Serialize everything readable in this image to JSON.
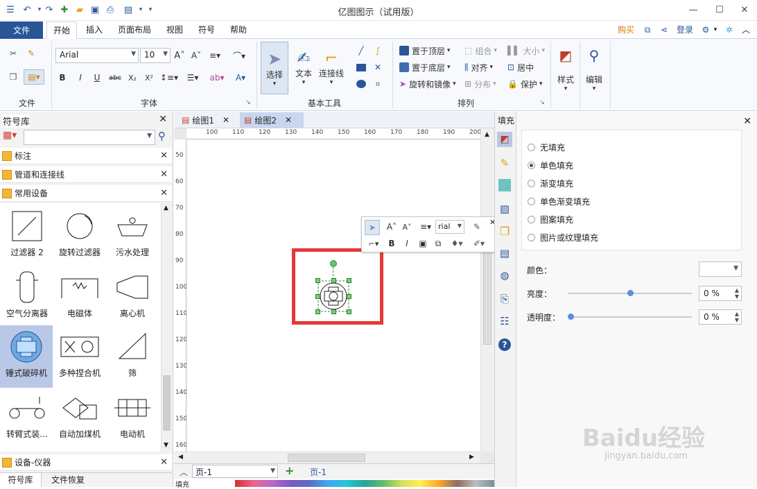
{
  "app": {
    "title": "亿图图示（试用版）"
  },
  "menu": {
    "file": "文件",
    "tabs": [
      "开始",
      "插入",
      "页面布局",
      "视图",
      "符号",
      "帮助"
    ],
    "buy": "购买",
    "login": "登录"
  },
  "ribbon": {
    "groups": {
      "file": "文件",
      "font": "字体",
      "basic_tools": "基本工具",
      "arrange": "排列"
    },
    "font_name": "Arial",
    "font_size": "10",
    "tools": {
      "select": "选择",
      "text": "文本",
      "connector": "连接线"
    },
    "arrange": {
      "bring_front": "置于顶层",
      "send_back": "置于底层",
      "rotate_mirror": "旋转和镜像",
      "group": "组合",
      "align": "对齐",
      "distribute": "分布",
      "size": "大小",
      "center": "居中",
      "protect": "保护"
    },
    "style": "样式",
    "edit": "编辑"
  },
  "library": {
    "title": "符号库",
    "search_placeholder": "",
    "categories": [
      "标注",
      "管道和连接线",
      "常用设备"
    ],
    "symbols": [
      "过滤器 2",
      "旋转过滤器",
      "污水处理",
      "空气分离器",
      "电磁体",
      "离心机",
      "锤式破碎机",
      "多种捏合机",
      "筛",
      "转臂式装...",
      "自动加煤机",
      "电动机"
    ],
    "bottom_category": "设备-仪器",
    "bottom_tabs": [
      "符号库",
      "文件恢复"
    ]
  },
  "doc_tabs": [
    "绘图1",
    "绘图2"
  ],
  "ruler": {
    "h": [
      "100",
      "110",
      "120",
      "130",
      "140",
      "150",
      "160",
      "170",
      "180",
      "190",
      "200"
    ],
    "v": [
      "50",
      "60",
      "70",
      "80",
      "90",
      "100",
      "110",
      "120",
      "130",
      "140",
      "150",
      "160"
    ]
  },
  "mini_toolbar": {
    "font": "rial"
  },
  "pages": {
    "current": "页-1",
    "tab": "页-1",
    "fill_label": "填充"
  },
  "fill_panel": {
    "title": "填充",
    "options": [
      "无填充",
      "单色填充",
      "渐变填充",
      "单色渐变填充",
      "图案填充",
      "图片或纹理填充"
    ],
    "selected": "单色填充",
    "color_label": "颜色：",
    "brightness_label": "亮度：",
    "brightness_value": "0 %",
    "brightness_level": 0.5,
    "transparency_label": "透明度：",
    "transparency_value": "0 %",
    "transparency_level": 0
  },
  "colors": {
    "accent": "#2a5699",
    "highlight": "#e53935",
    "selection": "#b8c8e6"
  },
  "watermark": {
    "text": "Baidu经验",
    "url": "jingyan.baidu.com"
  }
}
